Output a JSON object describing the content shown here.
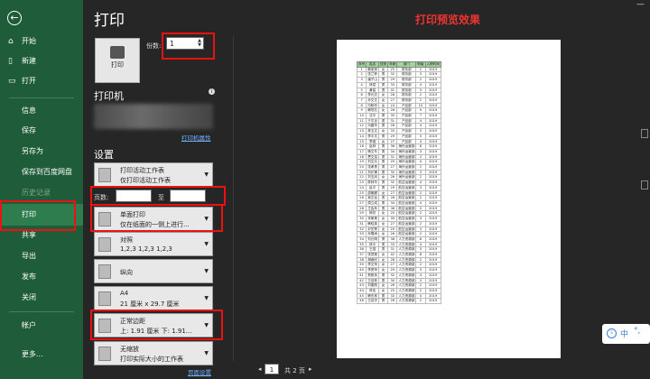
{
  "sidebar": {
    "back_icon": "back-arrow-icon",
    "items": [
      {
        "label": "开始",
        "icon": "home-icon"
      },
      {
        "label": "新建",
        "icon": "new-doc-icon"
      },
      {
        "label": "打开",
        "icon": "folder-open-icon"
      },
      {
        "label": "信息"
      },
      {
        "label": "保存"
      },
      {
        "label": "另存为"
      },
      {
        "label": "保存到百度网盘"
      },
      {
        "label": "历史记录"
      },
      {
        "label": "打印"
      },
      {
        "label": "共享"
      },
      {
        "label": "导出"
      },
      {
        "label": "发布"
      },
      {
        "label": "关闭"
      },
      {
        "label": "帐户"
      },
      {
        "label": "更多..."
      }
    ],
    "bg_color": "#1f5c3a",
    "selected_color": "#2e7d4f"
  },
  "main": {
    "title": "打印",
    "print_button_label": "打印",
    "copies_label": "份数:",
    "copies_value": "1",
    "printer_heading": "打印机",
    "printer_props_link": "打印机属性",
    "settings_heading": "设置",
    "options": [
      {
        "line1": "打印活动工作表",
        "line2": "仅打印活动工作表"
      },
      {
        "line1": "单面打印",
        "line2": "仅在纸面的一侧上进行..."
      },
      {
        "line1": "对照",
        "line2": "1,2,3    1,2,3    1,2,3"
      },
      {
        "line1": "纵向",
        "line2": ""
      },
      {
        "line1": "A4",
        "line2": "21 厘米 x 29.7 厘米"
      },
      {
        "line1": "正常边距",
        "line2": "上: 1.91 厘米 下: 1.91..."
      },
      {
        "line1": "无缩放",
        "line2": "打印实际大小的工作表"
      }
    ],
    "pages_label": "页数:",
    "to_label": "至",
    "page_setup_link": "页面设置"
  },
  "preview": {
    "title": "打印预览效果",
    "headers": [
      "序号",
      "姓名",
      "性别",
      "年龄",
      "部门",
      "职级",
      "入职时间"
    ],
    "rows": [
      [
        "1",
        "韩老师",
        "女",
        "25",
        "财务部",
        "2",
        "2019"
      ],
      [
        "2",
        "张兰菲",
        "男",
        "32",
        "财务部",
        "3",
        "2019"
      ],
      [
        "3",
        "潘子山",
        "男",
        "29",
        "财务部",
        "2",
        "2019"
      ],
      [
        "4",
        "林斌",
        "男",
        "33",
        "财务部",
        "4",
        "2019"
      ],
      [
        "5",
        "黄铭",
        "男",
        "31",
        "财务部",
        "3",
        "2019"
      ],
      [
        "6",
        "李元志",
        "女",
        "28",
        "财务部",
        "2",
        "2019"
      ],
      [
        "7",
        "孙文文",
        "女",
        "27",
        "财务部",
        "2",
        "2019"
      ],
      [
        "8",
        "冯昕彤",
        "女",
        "24",
        "产品部",
        "10",
        "2019"
      ],
      [
        "9",
        "韩坦石",
        "女",
        "26",
        "产品部",
        "9",
        "2019"
      ],
      [
        "10",
        "沈平",
        "男",
        "35",
        "产品部",
        "7",
        "2019"
      ],
      [
        "11",
        "于平京",
        "男",
        "31",
        "产品部",
        "4",
        "2019"
      ],
      [
        "12",
        "冯建华",
        "男",
        "28",
        "产品部",
        "4",
        "2019"
      ],
      [
        "13",
        "林玉文",
        "女",
        "33",
        "产品部",
        "3",
        "2019"
      ],
      [
        "14",
        "李平文",
        "男",
        "29",
        "产品部",
        "5",
        "2019"
      ],
      [
        "15",
        "李强",
        "女",
        "27",
        "产品部",
        "4",
        "2019"
      ],
      [
        "16",
        "赵林",
        "男",
        "36",
        "海外运营部",
        "8",
        "2019"
      ],
      [
        "17",
        "杨文东",
        "男",
        "34",
        "海外运营部",
        "3",
        "2019"
      ],
      [
        "18",
        "贾文浩",
        "男",
        "31",
        "海外运营部",
        "2",
        "2019"
      ],
      [
        "19",
        "刘文元",
        "男",
        "29",
        "海外运营部",
        "4",
        "2019"
      ],
      [
        "20",
        "张孝勇",
        "男",
        "27",
        "海外运营部",
        "2",
        "2019"
      ],
      [
        "21",
        "刘长锋",
        "男",
        "30",
        "海外运营部",
        "3",
        "2019"
      ],
      [
        "22",
        "刘玉凤",
        "女",
        "26",
        "海外运营部",
        "2",
        "2019"
      ],
      [
        "23",
        "陈林华",
        "男",
        "32",
        "航空运营部",
        "4",
        "2019"
      ],
      [
        "24",
        "赵平",
        "男",
        "29",
        "航空运营部",
        "3",
        "2019"
      ],
      [
        "25",
        "邵雅娜",
        "女",
        "27",
        "航空运营部",
        "2",
        "2019"
      ],
      [
        "26",
        "吴文龙",
        "男",
        "28",
        "航空运营部",
        "2",
        "2019"
      ],
      [
        "27",
        "周立成",
        "男",
        "34",
        "航空运营部",
        "4",
        "2019"
      ],
      [
        "28",
        "王会年",
        "男",
        "36",
        "航空运营部",
        "5",
        "2019"
      ],
      [
        "29",
        "杨芳",
        "女",
        "25",
        "航空运营部",
        "2",
        "2019"
      ],
      [
        "30",
        "宋家美",
        "女",
        "30",
        "航空运营部",
        "3",
        "2019"
      ],
      [
        "31",
        "韩桂英",
        "女",
        "27",
        "航空运营部",
        "2",
        "2019"
      ],
      [
        "32",
        "尹芝琴",
        "女",
        "29",
        "航空运营部",
        "3",
        "2019"
      ],
      [
        "33",
        "孙雪娇",
        "女",
        "26",
        "航空运营部",
        "2",
        "2019"
      ],
      [
        "34",
        "刘元明",
        "男",
        "38",
        "人力资源部",
        "6",
        "2019"
      ],
      [
        "35",
        "林平",
        "男",
        "33",
        "人力资源部",
        "4",
        "2019"
      ],
      [
        "36",
        "王强",
        "男",
        "31",
        "人力资源部",
        "3",
        "2019"
      ],
      [
        "37",
        "张茂莲",
        "女",
        "42",
        "人力资源部",
        "8",
        "2019"
      ],
      [
        "38",
        "胡雨欣",
        "女",
        "28",
        "人力资源部",
        "2",
        "2019"
      ],
      [
        "39",
        "李文萍",
        "女",
        "27",
        "人力资源部",
        "2",
        "2019"
      ],
      [
        "40",
        "李秀萍",
        "女",
        "29",
        "人力资源部",
        "3",
        "2019"
      ],
      [
        "41",
        "贺艳伟",
        "男",
        "32",
        "人力资源部",
        "4",
        "2019"
      ],
      [
        "42",
        "王佳林",
        "男",
        "30",
        "人力资源部",
        "3",
        "2019"
      ],
      [
        "43",
        "刘丽丽",
        "女",
        "26",
        "人力资源部",
        "2",
        "2019"
      ],
      [
        "44",
        "林佳",
        "女",
        "25",
        "人力资源部",
        "2",
        "2019"
      ],
      [
        "45",
        "韩东林",
        "男",
        "33",
        "人力资源部",
        "4",
        "2019"
      ],
      [
        "46",
        "王佳宇",
        "男",
        "28",
        "人力资源部",
        "2",
        "2019"
      ]
    ],
    "header_color": "#9fd49a"
  },
  "pager": {
    "current": "1",
    "total": "共 2 页",
    "prev_icon": "prev-arrow-icon",
    "next_icon": "next-arrow-icon"
  },
  "ime": {
    "zh": "中",
    "punct": "°,"
  }
}
